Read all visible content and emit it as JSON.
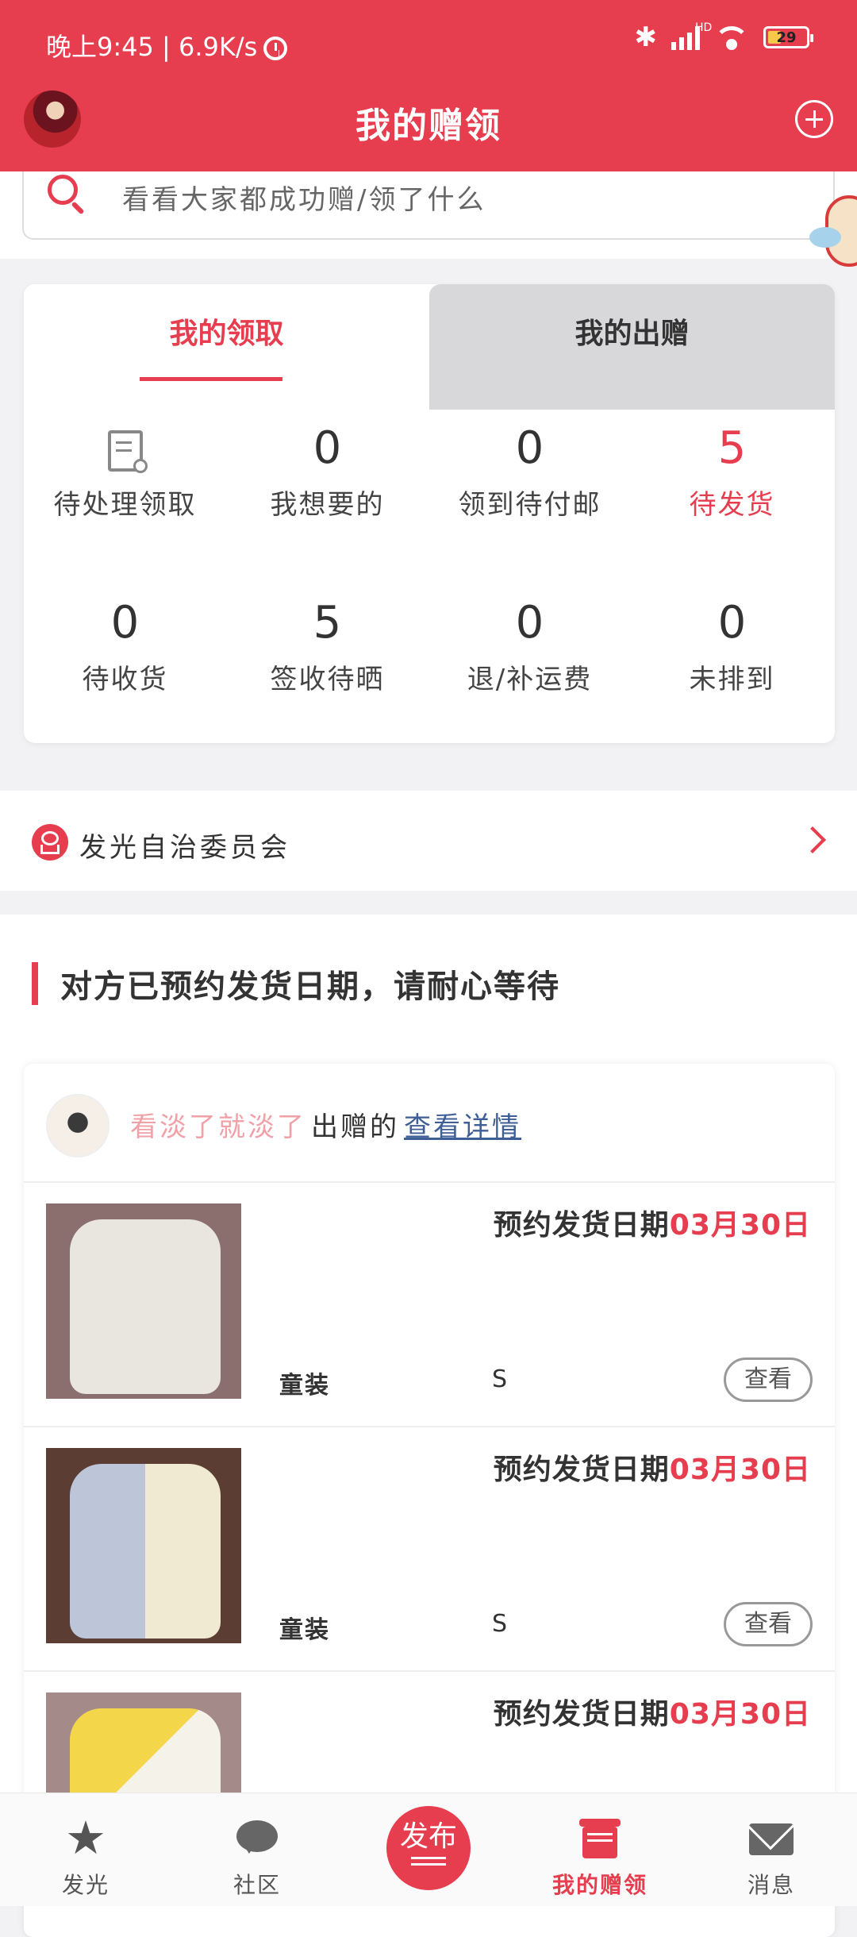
{
  "status_bar": {
    "time": "晚上9:45 | 6.9K/s",
    "battery": "29",
    "hd": "HD",
    "bluetooth_icon": "bluetooth-icon",
    "signal_icon": "signal-icon",
    "wifi_icon": "wifi-icon"
  },
  "header": {
    "title": "我的赠领",
    "add_icon": "plus-circle-icon",
    "accent": "#e63d4f"
  },
  "search": {
    "placeholder": "看看大家都成功赠/领了什么"
  },
  "tabs": [
    {
      "label": "我的领取",
      "active": true
    },
    {
      "label": "我的出赠",
      "active": false
    }
  ],
  "stats": [
    {
      "icon": "document-icon",
      "label": "待处理领取"
    },
    {
      "value": "0",
      "label": "我想要的"
    },
    {
      "value": "0",
      "label": "领到待付邮"
    },
    {
      "value": "5",
      "label": "待发货",
      "highlight": true
    },
    {
      "value": "0",
      "label": "待收货"
    },
    {
      "value": "5",
      "label": "签收待晒"
    },
    {
      "value": "0",
      "label": "退/补运费"
    },
    {
      "value": "0",
      "label": "未排到"
    }
  ],
  "committee": {
    "label": "发光自治委员会"
  },
  "section": {
    "title": "对方已预约发货日期，请耐心等待"
  },
  "giver": {
    "name": "看淡了就淡了",
    "action": "出赠的",
    "link": "查看详情"
  },
  "items": [
    {
      "ship_label": "预约发货日期",
      "ship_date": "03月30日",
      "category": "童装",
      "size": "S",
      "view": "查看"
    },
    {
      "ship_label": "预约发货日期",
      "ship_date": "03月30日",
      "category": "童装",
      "size": "S",
      "view": "查看"
    },
    {
      "ship_label": "预约发货日期",
      "ship_date": "03月30日",
      "category": "",
      "size": "",
      "view": ""
    }
  ],
  "tabbar": [
    {
      "label": "发光",
      "icon": "star-icon"
    },
    {
      "label": "社区",
      "icon": "chat-bubble-icon"
    },
    {
      "label": "发布",
      "icon": "publish-icon"
    },
    {
      "label": "我的赠领",
      "icon": "gift-icon",
      "active": true
    },
    {
      "label": "消息",
      "icon": "mail-icon"
    }
  ]
}
